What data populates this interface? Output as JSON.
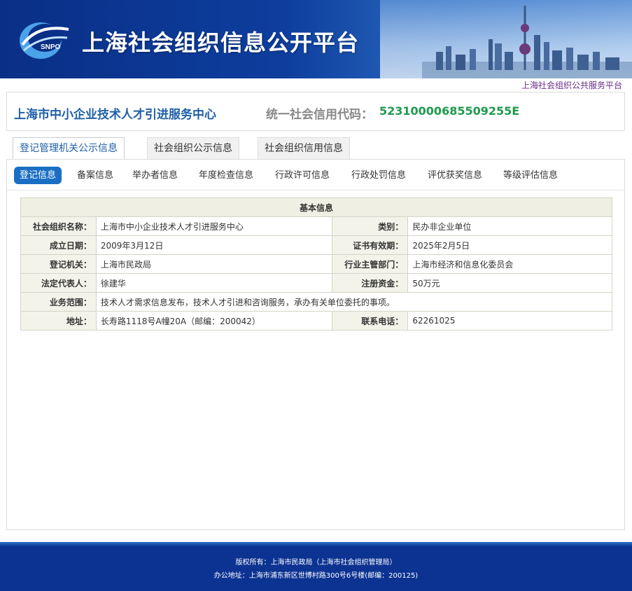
{
  "header": {
    "site_title": "上海社会组织信息公开平台",
    "service_link": "上海社会组织公共服务平台"
  },
  "org": {
    "name": "上海市中小企业技术人才引进服务中心",
    "code_label": "统一社会信用代码：",
    "code": "52310000685509255E"
  },
  "main_tabs": [
    {
      "label": "登记管理机关公示信息",
      "active": true
    },
    {
      "label": "社会组织公示信息",
      "active": false
    },
    {
      "label": "社会组织信用信息",
      "active": false
    }
  ],
  "sub_tabs": [
    {
      "label": "登记信息",
      "active": true
    },
    {
      "label": "备案信息"
    },
    {
      "label": "举办者信息"
    },
    {
      "label": "年度检查信息"
    },
    {
      "label": "行政许可信息"
    },
    {
      "label": "行政处罚信息"
    },
    {
      "label": "评优获奖信息"
    },
    {
      "label": "等级评估信息"
    }
  ],
  "basic_info": {
    "caption": "基本信息",
    "rows": [
      {
        "l1": "社会组织名称：",
        "v1": "上海市中小企业技术人才引进服务中心",
        "l2": "类别：",
        "v2": "民办非企业单位"
      },
      {
        "l1": "成立日期：",
        "v1": "2009年3月12日",
        "l2": "证书有效期：",
        "v2": "2025年2月5日"
      },
      {
        "l1": "登记机关：",
        "v1": "上海市民政局",
        "l2": "行业主管部门：",
        "v2": "上海市经济和信息化委员会"
      },
      {
        "l1": "法定代表人：",
        "v1": "徐建华",
        "l2": "注册资金：",
        "v2": "50万元"
      }
    ],
    "scope_label": "业务范围：",
    "scope_value": "技术人才需求信息发布，技术人才引进和咨询服务，承办有关单位委托的事项。",
    "last_row": {
      "l1": "地址：",
      "v1": "长寿路1118号A幢20A（邮编：200042）",
      "l2": "联系电话：",
      "v2": "62261025"
    }
  },
  "footer": {
    "line1": "版权所有：上海市民政局（上海市社会组织管理局）",
    "line2": "办公地址：上海市浦东新区世博村路300号6号楼(邮编：200125)"
  },
  "colors": {
    "banner": "#0c3392",
    "accent": "#1a6fc4",
    "code": "#1e9a4e"
  }
}
